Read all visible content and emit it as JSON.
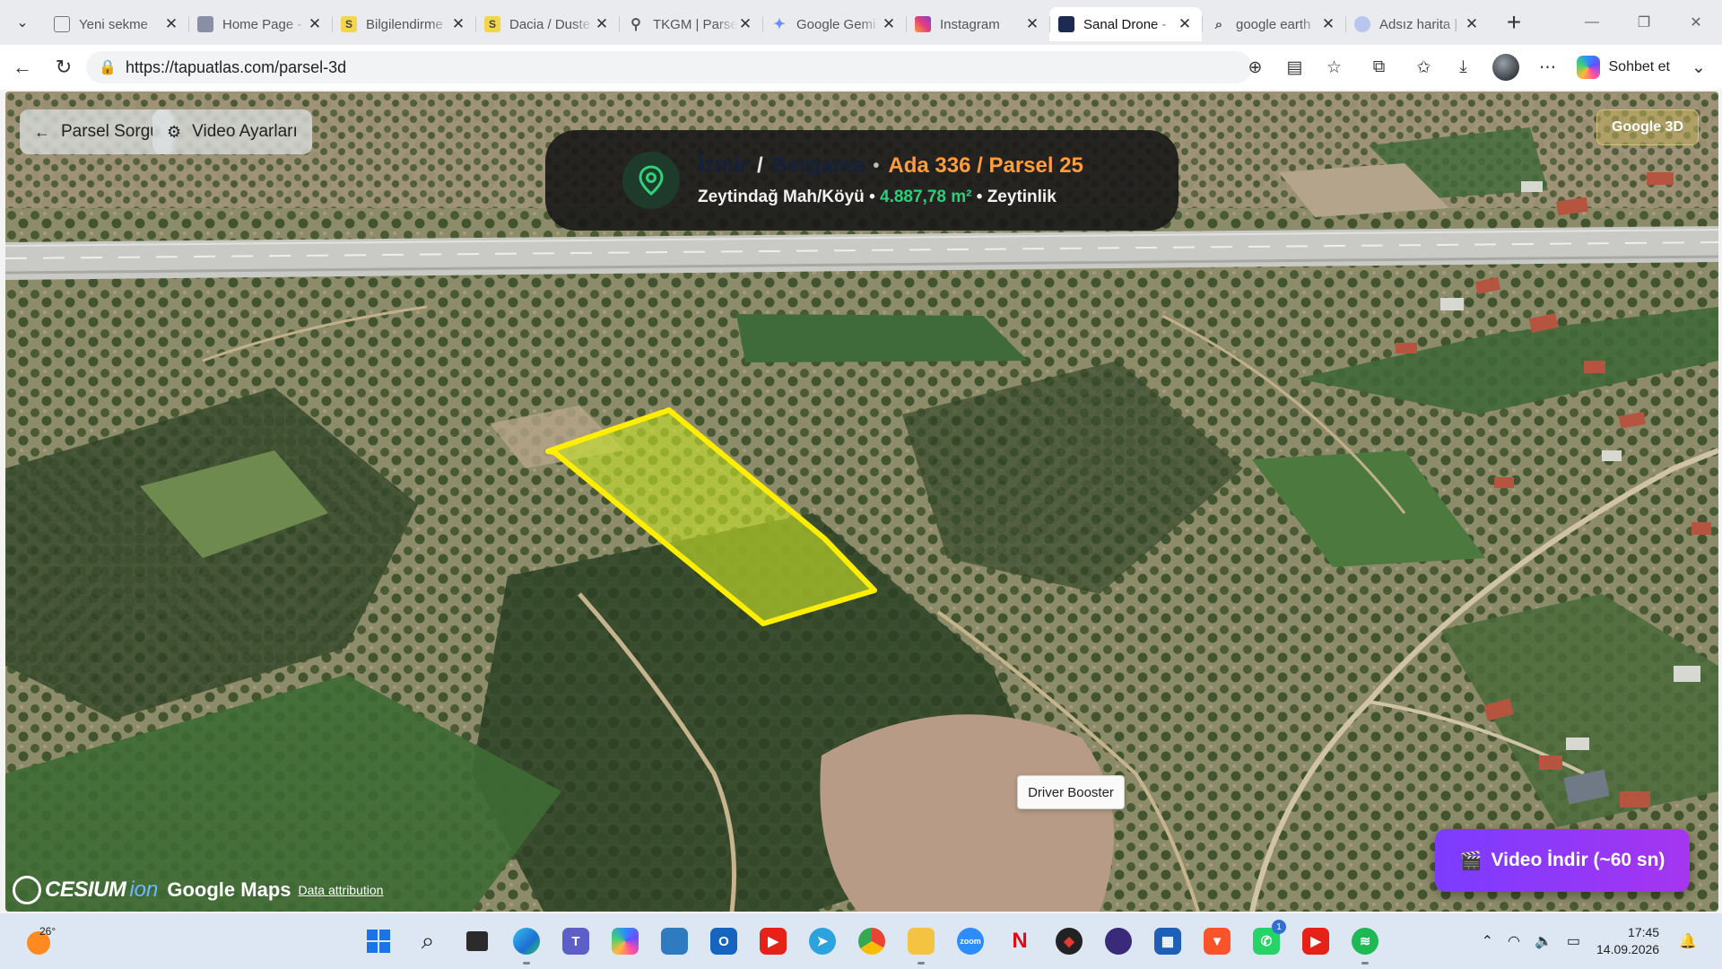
{
  "browser": {
    "tabs": [
      {
        "title": "Yeni sekme",
        "icon": "new-tab-page-icon",
        "active": false
      },
      {
        "title": "Home Page -",
        "icon": "home-page-icon",
        "active": false
      },
      {
        "title": "Bilgilendirme",
        "icon": "s-site-icon",
        "active": false
      },
      {
        "title": "Dacia / Duste",
        "icon": "s-site-icon",
        "active": false
      },
      {
        "title": "TKGM | Parse",
        "icon": "map-pin-icon",
        "active": false
      },
      {
        "title": "Google Gemi",
        "icon": "gemini-icon",
        "active": false
      },
      {
        "title": "Instagram",
        "icon": "instagram-icon",
        "active": false
      },
      {
        "title": "Sanal Drone -",
        "icon": "tapuatlas-icon",
        "active": true
      },
      {
        "title": "google earth",
        "icon": "search-icon",
        "active": false
      },
      {
        "title": "Adsız harita |",
        "icon": "my-maps-icon",
        "active": false
      }
    ],
    "url": "https://tapuatlas.com/parsel-3d",
    "copilot_label": "Sohbet et"
  },
  "map_ui": {
    "back_button": "Parsel Sorgu",
    "settings_button": "Video Ayarları",
    "google3d_badge": "Google 3D",
    "parcel": {
      "city": "İzmir",
      "district": "Bergama",
      "ada_parsel": "Ada 336 / Parsel 25",
      "neighborhood": "Zeytindağ Mah/Köyü",
      "area": "4.887,78 m²",
      "land_use": "Zeytinlik",
      "separator": "/",
      "bullet": "•"
    },
    "download_button": "Video İndir (~60 sn)",
    "attribution": {
      "cesium": "CESIUM",
      "ion": "ion",
      "google_maps": "Google Maps",
      "data_attribution": "Data attribution"
    },
    "tooltip": "Driver Booster",
    "parcel_outline_color": "#ffee00"
  },
  "taskbar": {
    "weather_temp": "26°",
    "pinned_apps": [
      "windows-start-icon",
      "search-icon",
      "task-view-icon",
      "edge-icon",
      "teams-icon",
      "copilot-icon",
      "keyboard-app-icon",
      "outlook-icon",
      "youtube-icon",
      "telegram-icon",
      "chrome-icon",
      "file-explorer-icon",
      "zoom-icon",
      "netflix-icon",
      "app-red-icon",
      "app-purple-icon",
      "microsoft-store-icon",
      "brave-icon",
      "whatsapp-icon",
      "youtube-music-icon",
      "spotify-icon"
    ],
    "whatsapp_badge": "1",
    "time": "17:45",
    "date": "14.09.2026"
  }
}
